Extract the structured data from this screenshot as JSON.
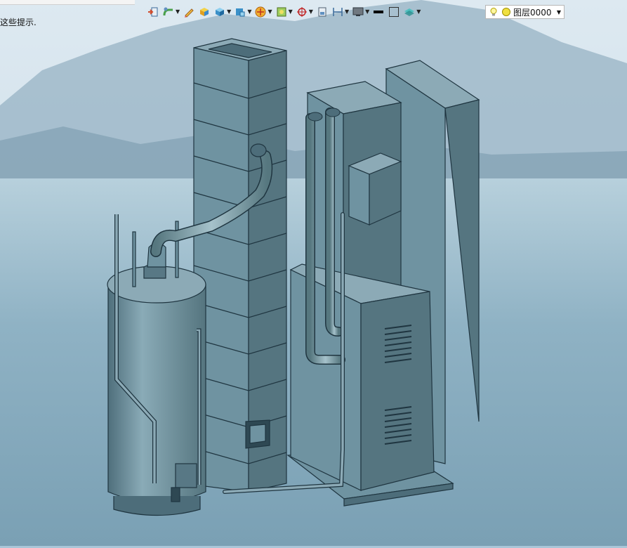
{
  "hint": {
    "text": "这些提示."
  },
  "toolbar": {
    "buttons": [
      {
        "name": "import-icon",
        "dropdown": false
      },
      {
        "name": "pipe-tool-icon",
        "dropdown": true
      },
      {
        "name": "pencil-icon",
        "dropdown": false
      },
      {
        "name": "box-color-icon",
        "dropdown": false
      },
      {
        "name": "cube-icon",
        "dropdown": true
      },
      {
        "name": "view-cube-icon",
        "dropdown": true
      },
      {
        "name": "orbit-icon",
        "dropdown": true
      },
      {
        "name": "render-icon",
        "dropdown": true
      },
      {
        "name": "snap-target-icon",
        "dropdown": true
      },
      {
        "name": "page-icon",
        "dropdown": false
      },
      {
        "name": "dimension-icon",
        "dropdown": true
      },
      {
        "name": "monitor-icon",
        "dropdown": true
      },
      {
        "name": "line-weight-icon",
        "dropdown": false
      },
      {
        "name": "rectangle-icon",
        "dropdown": false
      },
      {
        "name": "layers-icon",
        "dropdown": true
      }
    ]
  },
  "layer": {
    "name": "图层0000"
  },
  "colors": {
    "sky": "#c8dbe8",
    "water": "#8fb2c4",
    "model_fill": "#6f93a1",
    "model_dark": "#4d6d7a",
    "model_light": "#89aab6",
    "outline": "#1f3540"
  }
}
